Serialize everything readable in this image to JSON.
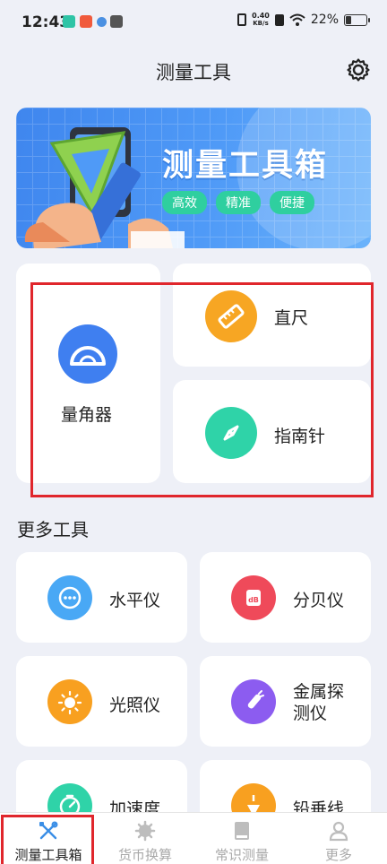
{
  "status_bar": {
    "time": "12:43",
    "net_speed_value": "0.40",
    "net_speed_unit": "KB/s",
    "battery": "22%"
  },
  "header": {
    "title": "测量工具",
    "settings_icon": "gear-icon"
  },
  "banner": {
    "title": "测量工具箱",
    "tags": [
      "高效",
      "精准",
      "便捷"
    ]
  },
  "main_tools": {
    "protractor": {
      "label": "量角器",
      "icon": "protractor-icon",
      "color": "#3f7ff0"
    },
    "ruler": {
      "label": "直尺",
      "icon": "ruler-icon",
      "color": "#f7a623"
    },
    "compass": {
      "label": "指南针",
      "icon": "compass-icon",
      "color": "#2fd3a8"
    }
  },
  "more_tools": {
    "section_title": "更多工具",
    "items": [
      {
        "label": "水平仪",
        "icon": "level-icon",
        "color": "#49a8f5"
      },
      {
        "label": "分贝仪",
        "icon": "decibel-icon",
        "color": "#ef4a5a"
      },
      {
        "label": "光照仪",
        "icon": "light-icon",
        "color": "#f8a020"
      },
      {
        "label": "金属探测仪",
        "icon": "metal-detector-icon",
        "color": "#8c5cf0"
      },
      {
        "label": "加速度",
        "icon": "accelerometer-icon",
        "color": "#2fd3a8"
      },
      {
        "label": "铅垂线",
        "icon": "plumb-line-icon",
        "color": "#f8a020"
      }
    ]
  },
  "bottom_nav": {
    "items": [
      {
        "label": "测量工具箱",
        "icon": "tools-icon",
        "active": true
      },
      {
        "label": "货币换算",
        "icon": "currency-icon",
        "active": false
      },
      {
        "label": "常识测量",
        "icon": "book-icon",
        "active": false
      },
      {
        "label": "更多",
        "icon": "user-icon",
        "active": false
      }
    ]
  }
}
